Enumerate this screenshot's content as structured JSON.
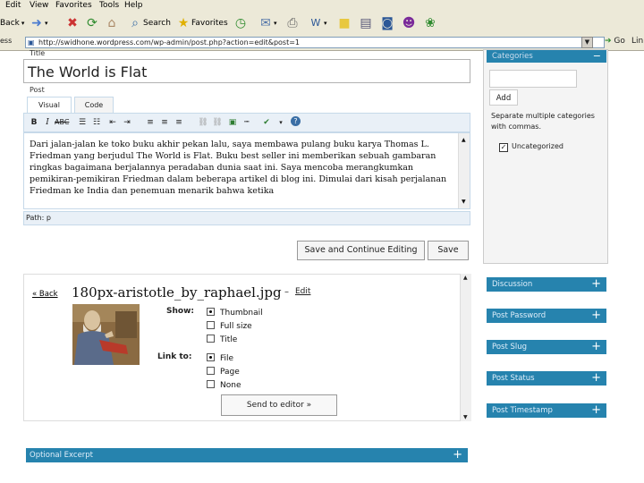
{
  "menu": [
    "Edit",
    "View",
    "Favorites",
    "Tools",
    "Help"
  ],
  "toolbar": {
    "back_label": "Back",
    "search_label": "Search",
    "favorites_label": "Favorites"
  },
  "address": {
    "label": "ess",
    "url": "http://swidhone.wordpress.com/wp-admin/post.php?action=edit&post=1",
    "go_label": "Go",
    "links_label": "Lin"
  },
  "post_editor": {
    "title_label": "Title",
    "title_value": "The World is Flat",
    "post_label": "Post",
    "tabs": [
      "Visual",
      "Code"
    ],
    "content": "Dari jalan-jalan ke toko buku akhir pekan lalu, saya membawa pulang buku karya Thomas L. Friedman yang berjudul The World is Flat. Buku best seller ini memberikan sebuah gambaran ringkas bagaimana berjalannya peradaban dunia saat ini. Saya mencoba merangkumkan pemikiran-pemikiran Friedman dalam beberapa artikel di blog ini. Dimulai dari kisah perjalanan Friedman ke India dan penemuan menarik bahwa ketika",
    "path_label": "Path: p",
    "save_continue_label": "Save and Continue Editing",
    "save_label": "Save"
  },
  "sidebar": {
    "categories_title": "Categories",
    "add_label": "Add",
    "note": "Separate multiple categories with commas.",
    "uncategorized_label": "Uncategorized",
    "panels": [
      "Discussion",
      "Post Password",
      "Post Slug",
      "Post Status",
      "Post Timestamp"
    ]
  },
  "uploader": {
    "back_label": "« Back",
    "image_title": "180px-aristotle_by_raphael.jpg",
    "dash": "–",
    "edit_label": "Edit",
    "show_label": "Show:",
    "show_options": [
      "Thumbnail",
      "Full size",
      "Title"
    ],
    "link_label": "Link to:",
    "link_options": [
      "File",
      "Page",
      "None"
    ],
    "send_label": "Send to editor »"
  },
  "excerpt": {
    "label": "Optional Excerpt"
  },
  "colors": {
    "panel_blue": "#2683ae",
    "chrome": "#ece9d8"
  }
}
